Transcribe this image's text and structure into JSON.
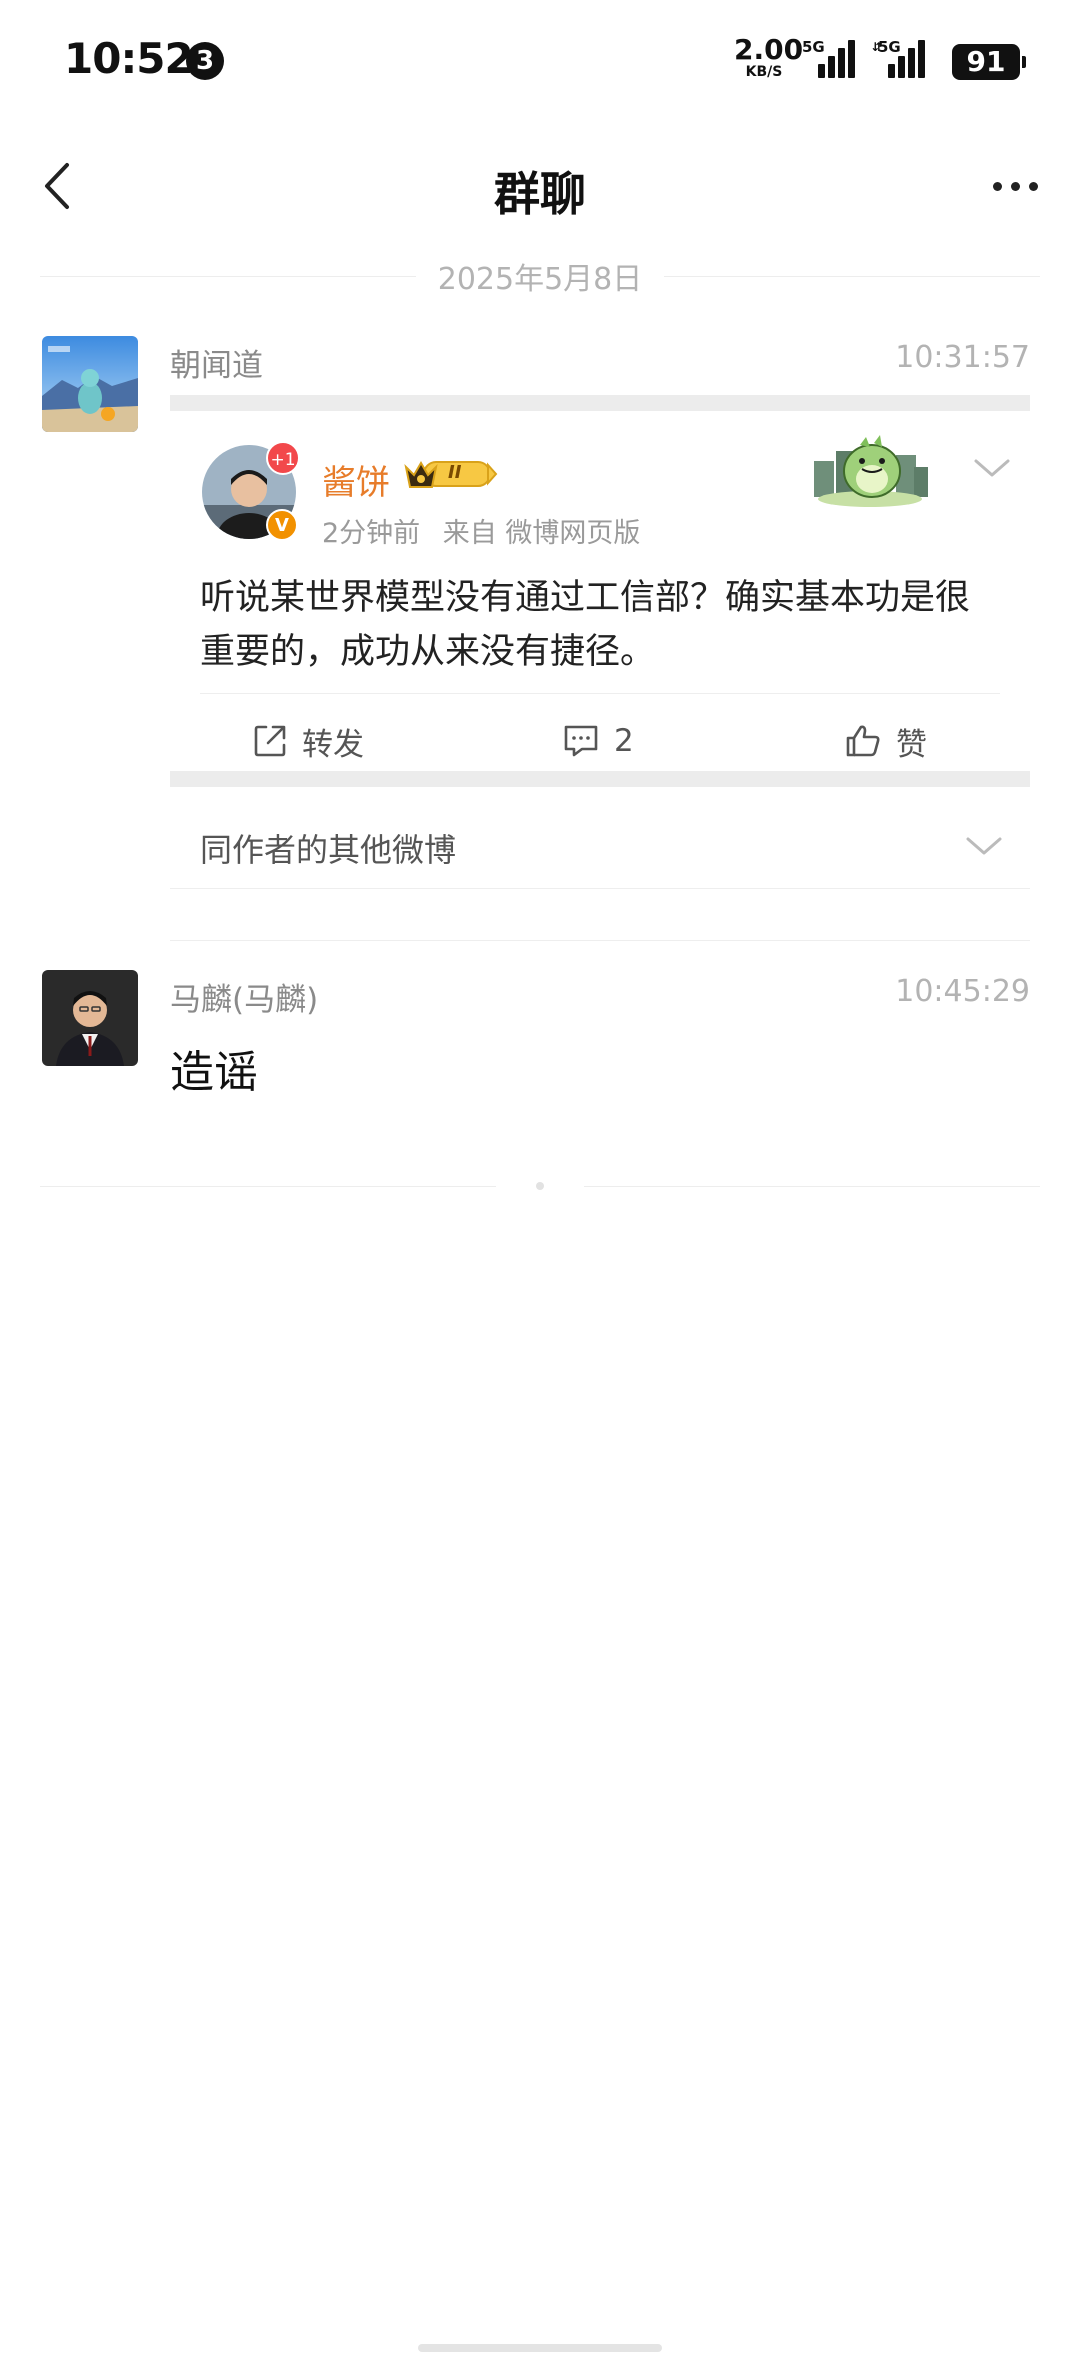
{
  "status_bar": {
    "time": "10:52",
    "notification_count": "3",
    "net_speed": "2.00",
    "net_speed_unit": "KB/S",
    "network_1": "5G",
    "network_2": "5G",
    "battery": "91"
  },
  "header": {
    "title": "群聊"
  },
  "date_divider": "2025年5月8日",
  "messages": [
    {
      "sender": "朝闻道",
      "time": "10:31:57",
      "card": {
        "author": "酱饼",
        "badge_plus": "+1",
        "verified": "V",
        "level_badge": "II",
        "meta_time": "2分钟前",
        "meta_source": "来自 微博网页版",
        "text": "听说某世界模型没有通过工信部？确实基本功是很重要的，成功从来没有捷径。",
        "actions": {
          "repost": "转发",
          "comment_count": "2",
          "like": "赞"
        }
      },
      "others": "同作者的其他微博"
    },
    {
      "sender": "马麟(马麟)",
      "time": "10:45:29",
      "text": "造谣"
    }
  ],
  "colors": {
    "author_orange": "#e77c2a",
    "divider_gray": "#ececec",
    "plus_badge_red": "#f2484b",
    "verified_orange": "#f29100"
  },
  "icons": [
    "back-arrow-icon",
    "more-icon",
    "repost-icon",
    "comment-icon",
    "like-icon",
    "chevron-down-icon",
    "crown-icon"
  ]
}
